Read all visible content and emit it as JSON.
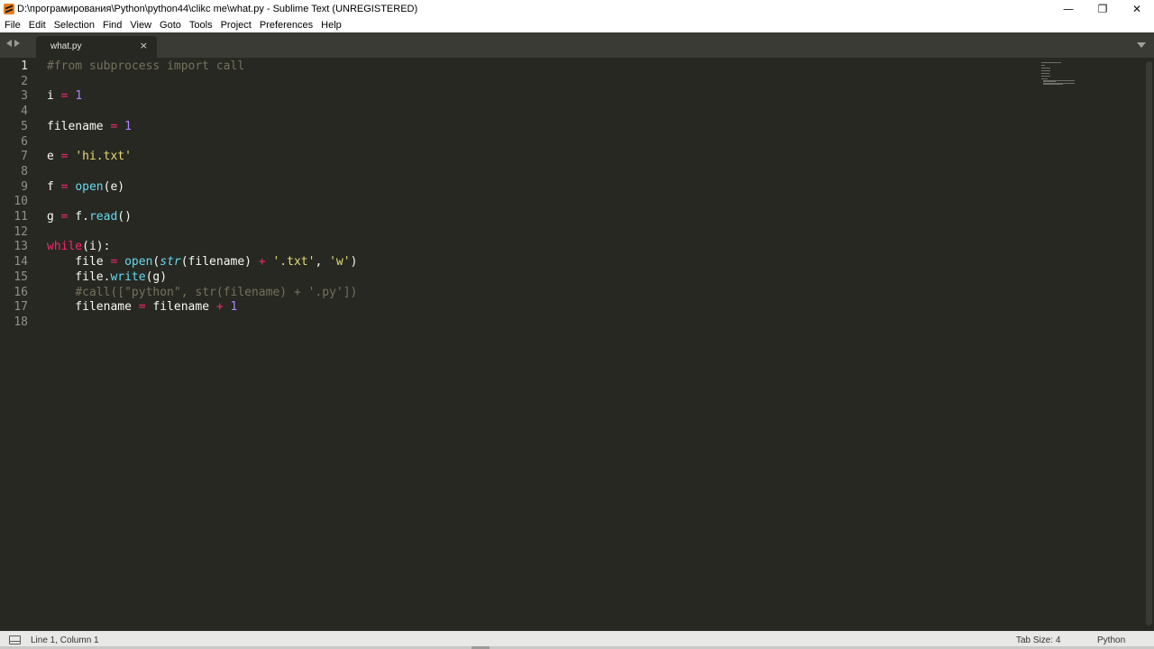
{
  "window": {
    "title": "D:\\програмирования\\Python\\python44\\clikc me\\what.py - Sublime Text (UNREGISTERED)",
    "controls": {
      "minimize": "—",
      "maximize": "❐",
      "close": "✕"
    }
  },
  "menu": [
    "File",
    "Edit",
    "Selection",
    "Find",
    "View",
    "Goto",
    "Tools",
    "Project",
    "Preferences",
    "Help"
  ],
  "tabs": [
    {
      "label": "what.py",
      "close": "×"
    }
  ],
  "code": {
    "line_numbers": [
      "1",
      "2",
      "3",
      "4",
      "5",
      "6",
      "7",
      "8",
      "9",
      "10",
      "11",
      "12",
      "13",
      "14",
      "15",
      "16",
      "17",
      "18"
    ],
    "lines": [
      [
        [
          "cm",
          "#from subprocess import call"
        ]
      ],
      [],
      [
        [
          "pl",
          "i "
        ],
        [
          "op",
          "="
        ],
        [
          "pl",
          " "
        ],
        [
          "num",
          "1"
        ]
      ],
      [],
      [
        [
          "pl",
          "filename "
        ],
        [
          "op",
          "="
        ],
        [
          "pl",
          " "
        ],
        [
          "num",
          "1"
        ]
      ],
      [],
      [
        [
          "pl",
          "e "
        ],
        [
          "op",
          "="
        ],
        [
          "pl",
          " "
        ],
        [
          "str",
          "'hi.txt'"
        ]
      ],
      [],
      [
        [
          "pl",
          "f "
        ],
        [
          "op",
          "="
        ],
        [
          "pl",
          " "
        ],
        [
          "fn",
          "open"
        ],
        [
          "pl",
          "(e)"
        ]
      ],
      [],
      [
        [
          "pl",
          "g "
        ],
        [
          "op",
          "="
        ],
        [
          "pl",
          " f."
        ],
        [
          "fn",
          "read"
        ],
        [
          "pl",
          "()"
        ]
      ],
      [],
      [
        [
          "kw",
          "while"
        ],
        [
          "pl",
          "(i):"
        ]
      ],
      [
        [
          "pl",
          "    file "
        ],
        [
          "op",
          "="
        ],
        [
          "pl",
          " "
        ],
        [
          "fn",
          "open"
        ],
        [
          "pl",
          "("
        ],
        [
          "bi",
          "str"
        ],
        [
          "pl",
          "(filename) "
        ],
        [
          "op",
          "+"
        ],
        [
          "pl",
          " "
        ],
        [
          "str",
          "'.txt'"
        ],
        [
          "pl",
          ", "
        ],
        [
          "str",
          "'w'"
        ],
        [
          "pl",
          ")"
        ]
      ],
      [
        [
          "pl",
          "    file."
        ],
        [
          "fn",
          "write"
        ],
        [
          "pl",
          "(g)"
        ]
      ],
      [
        [
          "pl",
          "    "
        ],
        [
          "cm",
          "#call([\"python\", str(filename) + '.py'])"
        ]
      ],
      [
        [
          "pl",
          "    filename "
        ],
        [
          "op",
          "="
        ],
        [
          "pl",
          " filename "
        ],
        [
          "op",
          "+"
        ],
        [
          "pl",
          " "
        ],
        [
          "num",
          "1"
        ]
      ],
      []
    ]
  },
  "status": {
    "position": "Line 1, Column 1",
    "tab_size": "Tab Size: 4",
    "syntax": "Python"
  },
  "colors": {
    "background": "#272822",
    "comment": "#75715e",
    "keyword": "#f92672",
    "number": "#ae81ff",
    "string": "#e6db74",
    "function": "#66d9ef"
  }
}
